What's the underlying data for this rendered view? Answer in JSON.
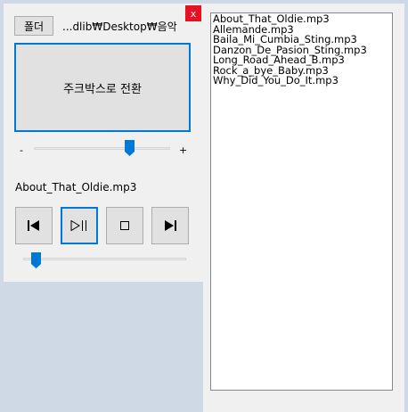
{
  "player": {
    "folder_button": "폴더",
    "path": "...dlib₩Desktop₩음악",
    "close_symbol": "x",
    "toggle_button": "주크박스로 전환",
    "volume_minus": "-",
    "volume_plus": "+",
    "volume_level": 0.72,
    "now_playing": "About_That_Oldie.mp3",
    "controls": {
      "previous_icon": "skip-previous-icon",
      "play_pause_icon": "play-pause-icon",
      "stop_icon": "stop-icon",
      "next_icon": "skip-next-icon"
    },
    "position_level": 0.05
  },
  "playlist": {
    "items": [
      "About_That_Oldie.mp3",
      "Allemande.mp3",
      "Baila_Mi_Cumbia_Sting.mp3",
      "Danzon_De_Pasion_Sting.mp3",
      "Long_Road_Ahead_B.mp3",
      "Rock_a_bye_Baby.mp3",
      "Why_Did_You_Do_It.mp3"
    ]
  },
  "colors": {
    "accent": "#0078d7",
    "close": "#e81123",
    "desktop": "#cfd9e6"
  }
}
